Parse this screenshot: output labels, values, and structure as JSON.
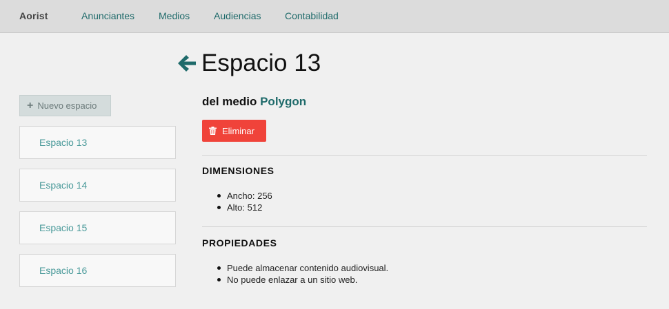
{
  "navbar": {
    "brand": "Aorist",
    "links": [
      "Anunciantes",
      "Medios",
      "Audiencias",
      "Contabilidad"
    ]
  },
  "sidebar": {
    "new_button": "Nuevo espacio",
    "items": [
      "Espacio 13",
      "Espacio 14",
      "Espacio 15",
      "Espacio 16"
    ]
  },
  "main": {
    "title": "Espacio 13",
    "subtitle_prefix": "del medio",
    "medium_name": "Polygon",
    "delete_label": "Eliminar",
    "dimensions": {
      "heading": "DIMENSIONES",
      "items": [
        "Ancho: 256",
        "Alto: 512"
      ]
    },
    "properties": {
      "heading": "PROPIEDADES",
      "items": [
        "Puede almacenar contenido audiovisual.",
        "No puede enlazar a un sitio web."
      ]
    }
  },
  "colors": {
    "accent": "#1e6a6a",
    "danger": "#f0433a",
    "navbar_bg": "#dcdcdc",
    "page_bg": "#f0f0f0"
  }
}
